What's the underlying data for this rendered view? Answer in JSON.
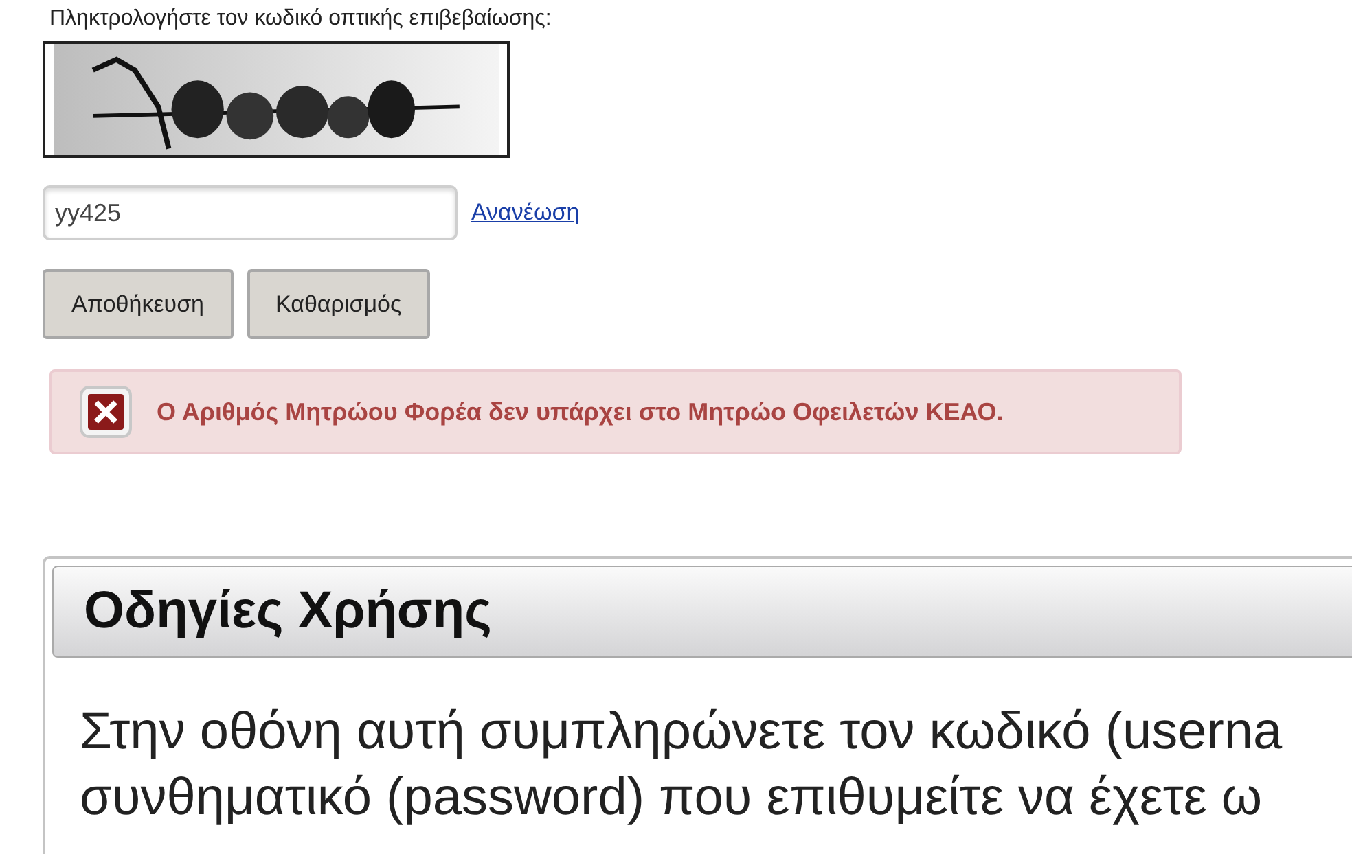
{
  "captcha": {
    "label": "Πληκτρολογήστε τον κωδικό οπτικής επιβεβαίωσης:",
    "input": {
      "value": "yy425"
    },
    "refresh_link": "Ανανέωση"
  },
  "buttons": [
    "Αποθήκευση",
    "Καθαρισμός"
  ],
  "alert": {
    "kind": "error",
    "message": "Ο Αριθμός Μητρώου Φορέα δεν υπάρχει στο Μητρώο Οφειλετών ΚΕΑΟ."
  },
  "instructions": {
    "title": "Οδηγίες Χρήσης",
    "lines": [
      "Στην οθόνη αυτή συμπληρώνετε τον κωδικό (userna",
      "συνθηματικό (password) που επιθυμείτε να έχετε ω"
    ]
  }
}
